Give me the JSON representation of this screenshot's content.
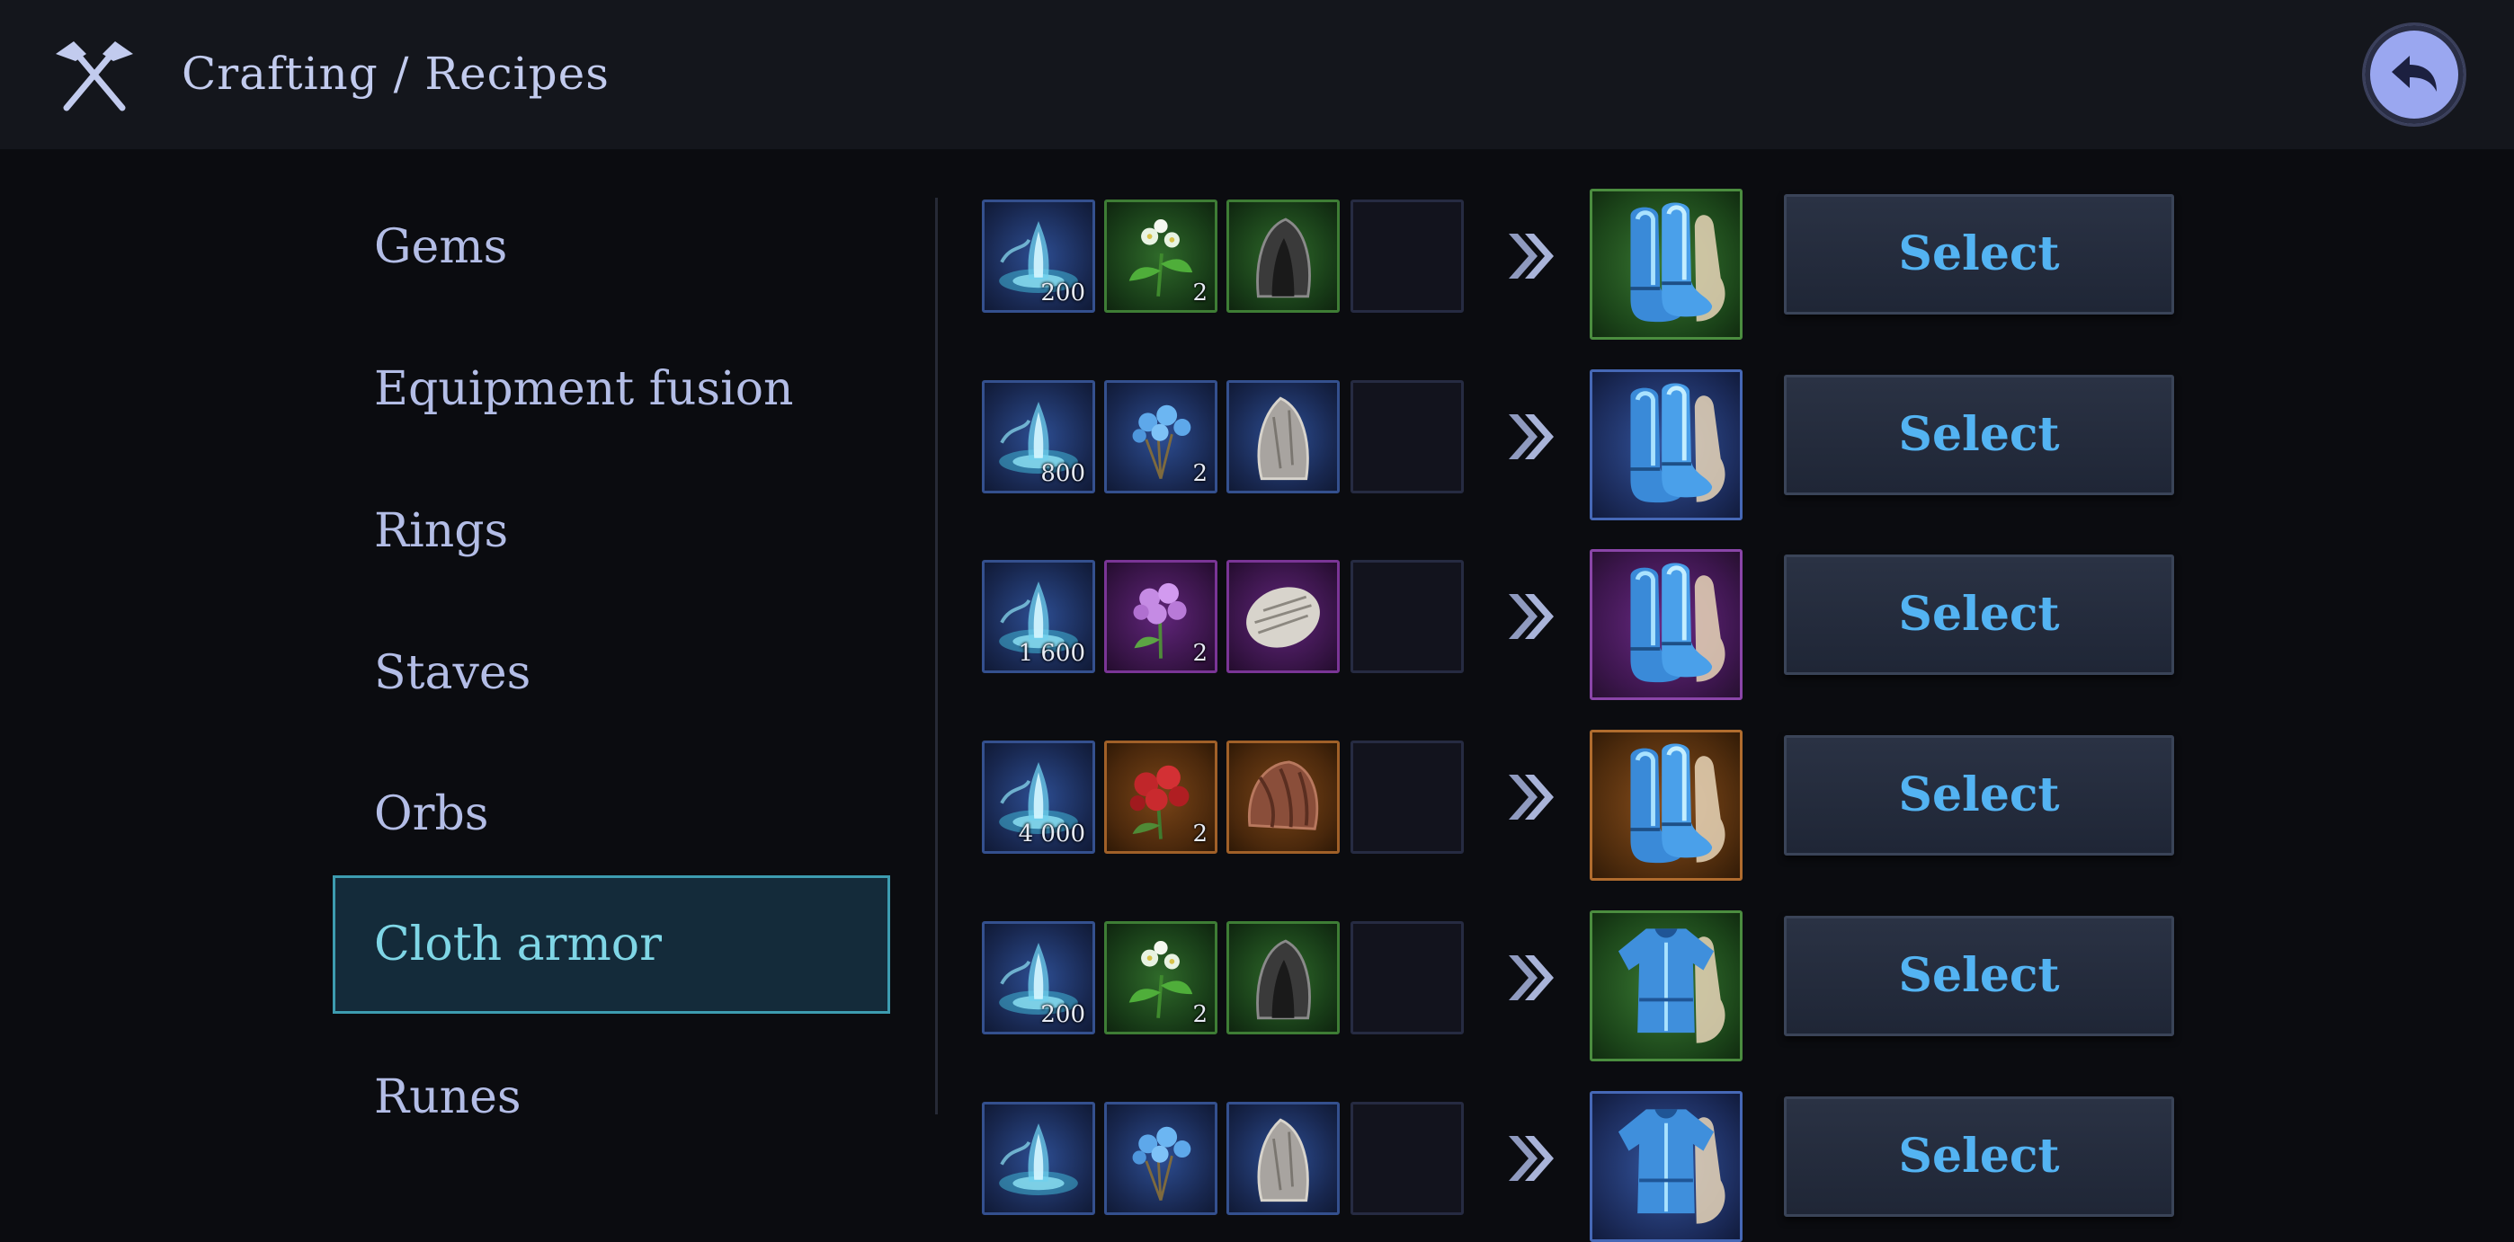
{
  "header": {
    "title": "Crafting / Recipes",
    "icon": "crossed-hammers-icon",
    "back_icon": "back-arrow-icon"
  },
  "categories": [
    {
      "label": "Gems",
      "active": false
    },
    {
      "label": "Equipment fusion",
      "active": false
    },
    {
      "label": "Rings",
      "active": false
    },
    {
      "label": "Staves",
      "active": false
    },
    {
      "label": "Orbs",
      "active": false
    },
    {
      "label": "Cloth armor",
      "active": true
    },
    {
      "label": "Runes",
      "active": false
    }
  ],
  "recipes": [
    {
      "rarity": "green",
      "essence_qty": "200",
      "flower_qty": "2",
      "result": "boots-icon",
      "select_label": "Select"
    },
    {
      "rarity": "blue",
      "essence_qty": "800",
      "flower_qty": "2",
      "result": "boots-icon",
      "select_label": "Select"
    },
    {
      "rarity": "purple",
      "essence_qty": "1 600",
      "flower_qty": "2",
      "result": "boots-icon",
      "select_label": "Select"
    },
    {
      "rarity": "orange",
      "essence_qty": "4 000",
      "flower_qty": "2",
      "result": "boots-icon",
      "select_label": "Select"
    },
    {
      "rarity": "green",
      "essence_qty": "200",
      "flower_qty": "2",
      "result": "robe-icon",
      "select_label": "Select"
    },
    {
      "rarity": "blue",
      "essence_qty": "",
      "flower_qty": "",
      "result": "robe-icon",
      "select_label": "Select"
    }
  ],
  "colors": {
    "accent": "#53b3f2",
    "active_category": "#7fd6e6",
    "active_border": "#3d9cb0",
    "background": "#0b0c10"
  }
}
